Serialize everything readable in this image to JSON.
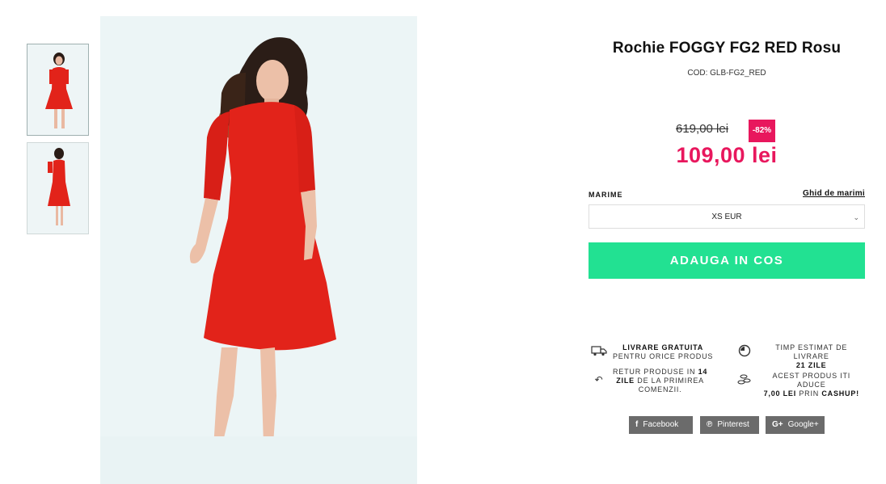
{
  "product": {
    "title": "Rochie FOGGY FG2 RED Rosu",
    "code": "COD: GLB-FG2_RED",
    "old_price": "619,00 lei",
    "discount": "-82%",
    "new_price": "109,00 lei"
  },
  "size": {
    "label": "MARIME",
    "guide_link": "Ghid de marimi",
    "selected": "XS EUR"
  },
  "cart": {
    "add_label": "ADAUGA IN COS"
  },
  "features": {
    "free_delivery": {
      "line1": "LIVRARE GRATUITA",
      "line2": "PENTRU ORICE PRODUS"
    },
    "delivery_time": {
      "line1": "TIMP ESTIMAT DE LIVRARE",
      "line2": "21 ZILE"
    },
    "returns": {
      "pre": "RETUR PRODUSE IN",
      "bold1": "14",
      "bold2": "ZILE",
      "post": "DE LA PRIMIREA",
      "line3": "COMENZII."
    },
    "cashup": {
      "line1": "ACEST PRODUS ITI ADUCE",
      "amount": "7,00 LEI",
      "mid": "PRIN",
      "brand": "CASHUP!"
    }
  },
  "share": {
    "facebook": "Facebook",
    "pinterest": "Pinterest",
    "google": "Google+"
  },
  "colors": {
    "accent": "#e8175d",
    "cta": "#22e192",
    "share_bg": "#6b6b6b",
    "dress": "#e2231a"
  },
  "icons": [
    "truck-icon",
    "clock-icon",
    "return-arrow-icon",
    "coins-icon",
    "facebook-icon",
    "pinterest-icon",
    "google-plus-icon",
    "chevron-down-icon"
  ]
}
